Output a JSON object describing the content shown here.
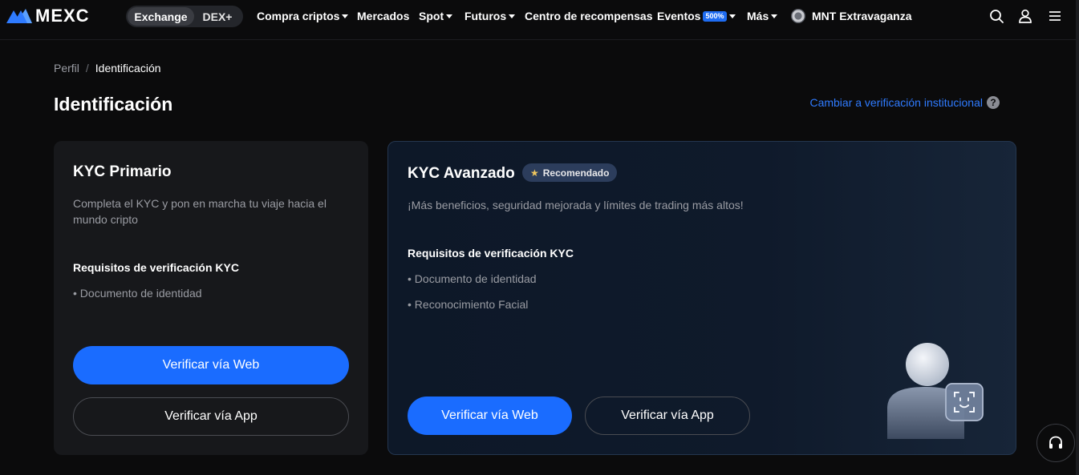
{
  "nav": {
    "brand": "MEXC",
    "segments": [
      {
        "label": "Exchange",
        "active": true
      },
      {
        "label": "DEX+",
        "active": false
      }
    ],
    "items": [
      {
        "label": "Compra criptos",
        "caret": true
      },
      {
        "label": "Mercados",
        "caret": false
      },
      {
        "label": "Spot",
        "caret": true
      },
      {
        "label": "Futuros",
        "caret": true
      },
      {
        "label": "Centro de recompensas",
        "caret": false
      },
      {
        "label": "Eventos",
        "badge": "500%",
        "caret": true
      },
      {
        "label": "Más",
        "caret": true
      },
      {
        "label": "MNT Extravaganza",
        "caret": false
      }
    ],
    "icons": [
      "search-icon",
      "user-icon",
      "menu-icon"
    ]
  },
  "breadcrumb": {
    "parent": "Perfil",
    "separator": "/",
    "current": "Identificación"
  },
  "page": {
    "title": "Identificación",
    "institutional_link": "Cambiar a verificación institucional"
  },
  "kyc_primary": {
    "title": "KYC Primario",
    "description": "Completa el KYC y pon en marcha tu viaje hacia el mundo cripto",
    "requirements_title": "Requisitos de verificación KYC",
    "requirements": [
      "• Documento de identidad"
    ],
    "verify_web": "Verificar vía Web",
    "verify_app": "Verificar vía App"
  },
  "kyc_advanced": {
    "title": "KYC Avanzado",
    "badge": "Recomendado",
    "description": "¡Más beneficios, seguridad mejorada y límites de trading más altos!",
    "requirements_title": "Requisitos de verificación KYC",
    "requirements": [
      "• Documento de identidad",
      "• Reconocimiento Facial"
    ],
    "verify_web": "Verificar vía Web",
    "verify_app": "Verificar vía App"
  },
  "colors": {
    "accent": "#1a6cff",
    "link": "#2f7bff",
    "background": "#0b0b0c",
    "card": "#17181b",
    "badge_bg": "#2c3d5c",
    "star": "#f0c75e"
  }
}
